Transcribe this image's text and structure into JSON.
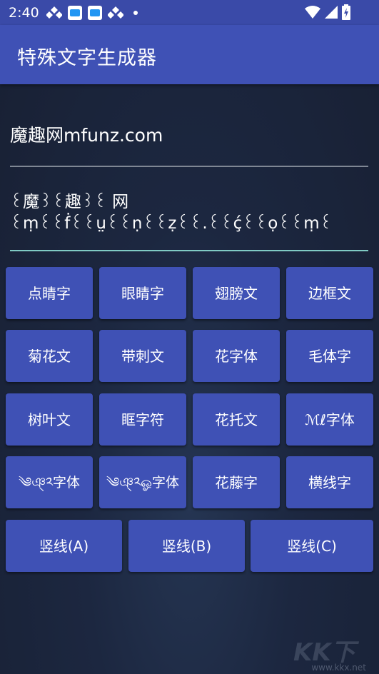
{
  "status_bar": {
    "time": "2:40",
    "icons": [
      "diamond-icon",
      "app-notification-icon",
      "app-notification-icon",
      "diamond-icon",
      "dot-icon",
      "wifi-icon",
      "signal-icon",
      "battery-icon"
    ]
  },
  "app_bar": {
    "title": "特殊文字生成器"
  },
  "input": {
    "value": "魔趣网mfunz.com"
  },
  "output": {
    "value": "꒰魔꒱꒰趣꒱꒰ 网\n꒰ṃ꒰꒰ḟ꒰꒰ṳ꒰꒰ṇ꒰꒰ẓ꒰꒰.꒰꒰ḉ꒰꒰ọ꒰꒰ṃ꒰"
  },
  "buttons": {
    "row1": [
      "点睛字",
      "眼睛字",
      "翅膀文",
      "边框文"
    ],
    "row2": [
      "菊花文",
      "带刺文",
      "花字体",
      "毛体字"
    ],
    "row3": [
      "树叶文",
      "眶字符",
      "花托文",
      "ℳℓ字体"
    ],
    "row4": [
      "༄ঞ্༢字体",
      "༄ঞ্༢ஓ字体",
      "花藤字",
      "横线字"
    ],
    "row5": [
      "竖线(A)",
      "竖线(B)",
      "竖线(C)"
    ]
  },
  "watermark": {
    "text": "www.kkx.net",
    "logo": "KK下载"
  },
  "colors": {
    "primary": "#3f51b5",
    "status_bar": "#3a4aa8",
    "background": "#1c2740",
    "accent_underline": "#80cbc4"
  }
}
